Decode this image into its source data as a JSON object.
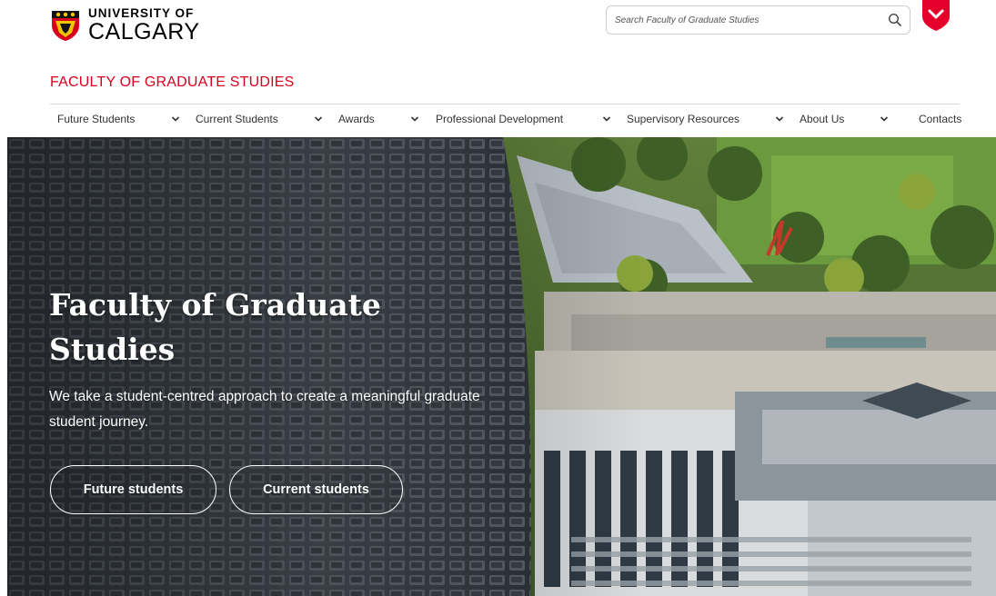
{
  "header": {
    "logo_line1": "UNIVERSITY OF",
    "logo_line2": "CALGARY",
    "search_placeholder": "Search Faculty of Graduate Studies",
    "faculty_title": "FACULTY OF GRADUATE STUDIES"
  },
  "nav": {
    "items": [
      {
        "label": "Future Students",
        "icon": "chevron-down-icon"
      },
      {
        "label": "Current Students",
        "icon": "chevron-down-icon"
      },
      {
        "label": "Awards",
        "icon": "chevron-down-icon"
      },
      {
        "label": "Professional Development",
        "icon": "chevron-down-icon"
      },
      {
        "label": "Supervisory Resources",
        "icon": "chevron-down-icon"
      },
      {
        "label": "About Us",
        "icon": "chevron-down-icon"
      },
      {
        "label": "Contacts"
      }
    ]
  },
  "hero": {
    "title_line1": "Faculty of Graduate",
    "title_line2": "Studies",
    "subtitle": "We take a student-centred approach to create a meaningful graduate student journey.",
    "buttons": [
      {
        "label": "Future students"
      },
      {
        "label": "Current students"
      }
    ]
  },
  "colors": {
    "brand_red": "#d6001c",
    "text": "#333333",
    "hero_text": "#ffffff"
  }
}
